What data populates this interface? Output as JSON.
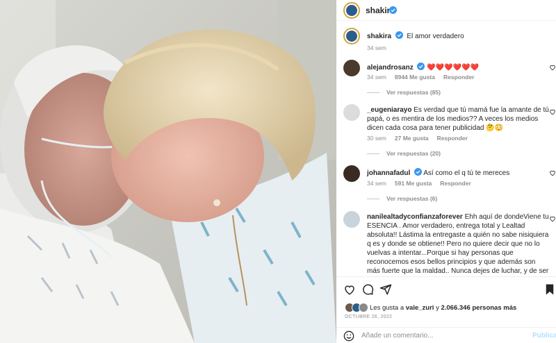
{
  "header": {
    "username": "shakira"
  },
  "caption": {
    "username": "shakira",
    "text": "El amor verdadero",
    "time": "34 sem"
  },
  "comments": [
    {
      "username": "alejandrosanz",
      "text": "❤️❤️❤️❤️❤️❤️",
      "time": "34 sem",
      "likes": "8944 Me gusta",
      "reply": "Responder",
      "view_replies": "Ver respuestas (85)"
    },
    {
      "username": "_eugeniarayo",
      "text": "Es verdad que tú mamá fue la amante de tú papá, o es mentira de los medios?? A veces los medios dicen cada cosa para tener publicidad 🤔😳",
      "time": "30 sem",
      "likes": "27 Me gusta",
      "reply": "Responder",
      "view_replies": "Ver respuestas (20)"
    },
    {
      "username": "johannafadul",
      "text": "Así como el q tú te mereces",
      "time": "34 sem",
      "likes": "591 Me gusta",
      "reply": "Responder",
      "view_replies": "Ver respuestas (6)"
    },
    {
      "username": "nanilealtadyconfianzaforever",
      "text": "Ehh aquí de dondeViene tu ESENCIA . Amor verdadero, entrega total y Lealtad absoluta!! Lástima la entregaste a quién no sabe nisiquiera q es y donde se obtiene!! Pero no quiere decir que no lo vuelvas a intentar...Porque si hay personas que reconocemos esos bellos principios y que además son más fuerte que la maldad.. Nunca dejes de luchar, y de ser la persona maravillosa que estás destinada. . le duela a quien le duela. Eres Maravillosa"
    }
  ],
  "likes_line": {
    "prefix": "Les gusta a ",
    "user": "vale_zuri",
    "middle": " y ",
    "count": "2.066.346 personas más"
  },
  "date": "OCTUBRE 26, 2022",
  "add_comment": {
    "placeholder": "Añade un comentario...",
    "publish": "Publicar"
  },
  "colors": {
    "verified": "#3897f0",
    "heart": "#ed4956",
    "ring": "#d3a43a",
    "publish": "#b2dffc"
  },
  "icons": [
    "heart-icon",
    "comment-icon",
    "share-icon",
    "bookmark-icon",
    "emoji-icon",
    "verified-icon"
  ]
}
